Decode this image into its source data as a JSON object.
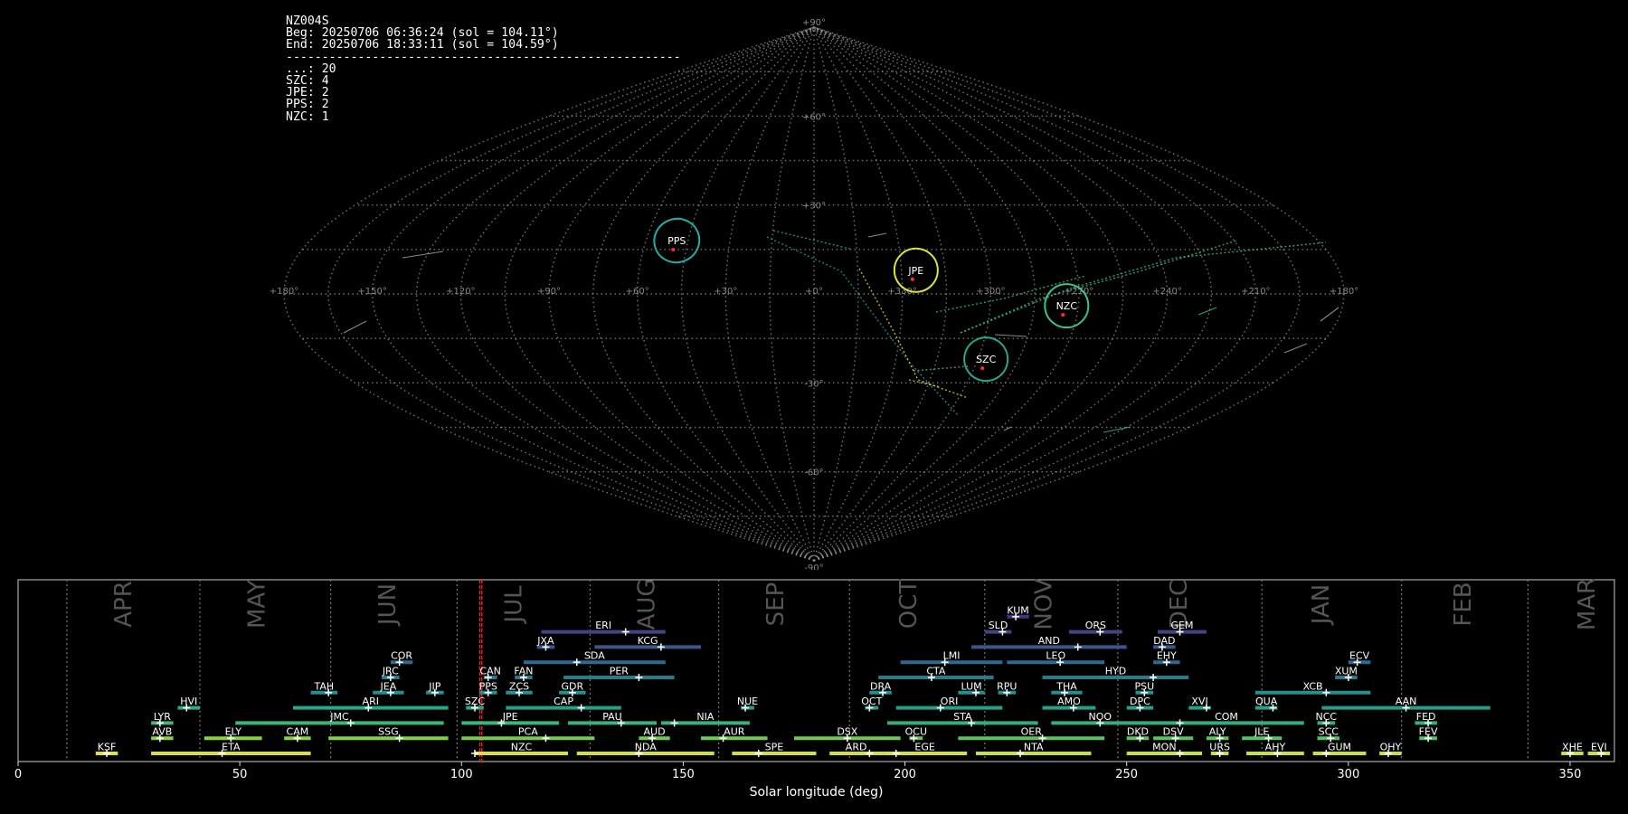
{
  "info": {
    "lines": [
      "NZ004S",
      "Beg: 20250706 06:36:24 (sol = 104.11°)",
      "End: 20250706 18:33:11 (sol = 104.59°)",
      "-------------------------------------------------------",
      "...: 20",
      "SZC: 4",
      "JPE: 2",
      "PPS: 2",
      "NZC: 1"
    ]
  },
  "sky_map": {
    "projection": "sinusoidal",
    "lon_tick_labels": [
      "+180°",
      "+150°",
      "+120°",
      "+90°",
      "+60°",
      "+30°",
      "+0°",
      "+330°",
      "+300°",
      "+270°",
      "+240°",
      "+210°",
      "+180°"
    ],
    "lat_tick_labels": [
      "+90°",
      "+60°",
      "+30°",
      "-30°",
      "-60°",
      "-90°"
    ],
    "grid_color": "#9a9a9a",
    "radiants": [
      {
        "code": "PPS",
        "lon": 49,
        "lat": 18,
        "color": "#20b0a8"
      },
      {
        "code": "JPE",
        "lon": -35,
        "lat": 8,
        "color": "#dde040"
      },
      {
        "code": "NZC",
        "lon": -86,
        "lat": -4,
        "color": "#3cc488"
      },
      {
        "code": "SZC",
        "lon": -63,
        "lat": -22,
        "color": "#24a88c"
      }
    ]
  },
  "chart_data": {
    "type": "bar",
    "title": "",
    "xlabel": "Solar longitude (deg)",
    "ylabel": "",
    "xlim": [
      0,
      360
    ],
    "x_ticks": [
      0,
      50,
      100,
      150,
      200,
      250,
      300,
      350
    ],
    "current_sol": [
      104.11,
      104.59
    ],
    "months": [
      {
        "name": "APR",
        "boundary": 11,
        "label_at": 24
      },
      {
        "name": "MAY",
        "boundary": 41,
        "label_at": 54
      },
      {
        "name": "JUN",
        "boundary": 70.5,
        "label_at": 83.5
      },
      {
        "name": "JUL",
        "boundary": 99,
        "label_at": 112
      },
      {
        "name": "AUG",
        "boundary": 129,
        "label_at": 142
      },
      {
        "name": "SEP",
        "boundary": 158,
        "label_at": 171
      },
      {
        "name": "OCT",
        "boundary": 187.5,
        "label_at": 201
      },
      {
        "name": "NOV",
        "boundary": 218,
        "label_at": 231.5
      },
      {
        "name": "DEC",
        "boundary": 248,
        "label_at": 262
      },
      {
        "name": "JAN",
        "boundary": 280.5,
        "label_at": 294
      },
      {
        "name": "FEB",
        "boundary": 312,
        "label_at": 326
      },
      {
        "name": "MAR",
        "boundary": 340.5,
        "label_at": 354
      }
    ],
    "showers": [
      {
        "code": "KSF",
        "start": 17.5,
        "end": 22.5,
        "peak": 20,
        "row": 0,
        "color": "#e0e040"
      },
      {
        "code": "ETA",
        "start": 30,
        "end": 66,
        "peak": 46,
        "row": 0,
        "color": "#d8e040"
      },
      {
        "code": "NZC",
        "start": 103,
        "end": 124,
        "peak": 103,
        "row": 0,
        "color": "#d8e040"
      },
      {
        "code": "NDA",
        "start": 126,
        "end": 157,
        "peak": 140,
        "row": 0,
        "color": "#d0e040"
      },
      {
        "code": "SPE",
        "start": 161,
        "end": 180,
        "peak": 167,
        "row": 0,
        "color": "#d0e040"
      },
      {
        "code": "ARD",
        "start": 183,
        "end": 195,
        "peak": 192,
        "row": 0,
        "color": "#d0e040"
      },
      {
        "code": "EGE",
        "start": 195,
        "end": 214,
        "peak": 198,
        "row": 0,
        "color": "#d0e040"
      },
      {
        "code": "NTA",
        "start": 216,
        "end": 242,
        "peak": 226,
        "row": 0,
        "color": "#c8e040"
      },
      {
        "code": "MON",
        "start": 250,
        "end": 267,
        "peak": 262,
        "row": 0,
        "color": "#c8e040"
      },
      {
        "code": "URS",
        "start": 269,
        "end": 273,
        "peak": 271,
        "row": 0,
        "color": "#c8e040"
      },
      {
        "code": "AHY",
        "start": 277,
        "end": 290,
        "peak": 284,
        "row": 0,
        "color": "#c8e040"
      },
      {
        "code": "GUM",
        "start": 292,
        "end": 304,
        "peak": 295,
        "row": 0,
        "color": "#c8e040"
      },
      {
        "code": "OHY",
        "start": 307,
        "end": 312,
        "peak": 309,
        "row": 0,
        "color": "#c8e040"
      },
      {
        "code": "XHE",
        "start": 348,
        "end": 353,
        "peak": 350,
        "row": 0,
        "color": "#c8e040"
      },
      {
        "code": "EVI",
        "start": 354,
        "end": 359,
        "peak": 357,
        "row": 0,
        "color": "#c8e040"
      },
      {
        "code": "AVB",
        "start": 30,
        "end": 35,
        "peak": 32,
        "row": 1,
        "color": "#88d048"
      },
      {
        "code": "ELY",
        "start": 42,
        "end": 55,
        "peak": 48,
        "row": 1,
        "color": "#88d048"
      },
      {
        "code": "CAM",
        "start": 60,
        "end": 66,
        "peak": 63,
        "row": 1,
        "color": "#88d048"
      },
      {
        "code": "SSG",
        "start": 70,
        "end": 97,
        "peak": 86,
        "row": 1,
        "color": "#80d050"
      },
      {
        "code": "PCA",
        "start": 100,
        "end": 130,
        "peak": 119,
        "row": 1,
        "color": "#78c858"
      },
      {
        "code": "AUD",
        "start": 140,
        "end": 147,
        "peak": 143,
        "row": 1,
        "color": "#70c858"
      },
      {
        "code": "AUR",
        "start": 154,
        "end": 169,
        "peak": 159,
        "row": 1,
        "color": "#70c858"
      },
      {
        "code": "DSX",
        "start": 175,
        "end": 199,
        "peak": 187,
        "row": 1,
        "color": "#70c858"
      },
      {
        "code": "OCU",
        "start": 201,
        "end": 204,
        "peak": 202,
        "row": 1,
        "color": "#68c060"
      },
      {
        "code": "OER",
        "start": 212,
        "end": 245,
        "peak": 231,
        "row": 1,
        "color": "#60c060"
      },
      {
        "code": "DKD",
        "start": 250,
        "end": 255,
        "peak": 253,
        "row": 1,
        "color": "#60c060"
      },
      {
        "code": "DSV",
        "start": 256,
        "end": 265,
        "peak": 261,
        "row": 1,
        "color": "#60c060"
      },
      {
        "code": "ALY",
        "start": 268,
        "end": 273,
        "peak": 271,
        "row": 1,
        "color": "#60c060"
      },
      {
        "code": "JLE",
        "start": 276,
        "end": 285,
        "peak": 282,
        "row": 1,
        "color": "#58c068"
      },
      {
        "code": "SCC",
        "start": 293,
        "end": 298,
        "peak": 296,
        "row": 1,
        "color": "#58c068"
      },
      {
        "code": "FEV",
        "start": 316,
        "end": 320,
        "peak": 318,
        "row": 1,
        "color": "#58c068"
      },
      {
        "code": "LYR",
        "start": 30,
        "end": 35,
        "peak": 32,
        "row": 2,
        "color": "#40b878"
      },
      {
        "code": "JMC",
        "start": 49,
        "end": 96,
        "peak": 75,
        "row": 2,
        "color": "#38b878"
      },
      {
        "code": "JPE",
        "start": 100,
        "end": 122,
        "peak": 109,
        "row": 2,
        "color": "#38b878"
      },
      {
        "code": "PAU",
        "start": 124,
        "end": 144,
        "peak": 136,
        "row": 2,
        "color": "#38b080"
      },
      {
        "code": "NIA",
        "start": 145,
        "end": 165,
        "peak": 148,
        "row": 2,
        "color": "#38b080"
      },
      {
        "code": "STA",
        "start": 196,
        "end": 230,
        "peak": 215,
        "row": 2,
        "color": "#30b080"
      },
      {
        "code": "NOO",
        "start": 233,
        "end": 255,
        "peak": 244,
        "row": 2,
        "color": "#30b080"
      },
      {
        "code": "COM",
        "start": 255,
        "end": 290,
        "peak": 262,
        "row": 2,
        "color": "#30b080"
      },
      {
        "code": "NCC",
        "start": 293,
        "end": 297,
        "peak": 295,
        "row": 2,
        "color": "#30b080"
      },
      {
        "code": "FED",
        "start": 315,
        "end": 320,
        "peak": 318,
        "row": 2,
        "color": "#30b080"
      },
      {
        "code": "HVI",
        "start": 36,
        "end": 41,
        "peak": 38,
        "row": 3,
        "color": "#2aa888"
      },
      {
        "code": "ARI",
        "start": 62,
        "end": 97,
        "peak": 79,
        "row": 3,
        "color": "#28a888"
      },
      {
        "code": "SZC",
        "start": 101,
        "end": 105,
        "peak": 103,
        "row": 3,
        "color": "#28a888"
      },
      {
        "code": "CAP",
        "start": 110,
        "end": 136,
        "peak": 127,
        "row": 3,
        "color": "#28a088"
      },
      {
        "code": "NUE",
        "start": 163,
        "end": 166,
        "peak": 164,
        "row": 3,
        "color": "#28a088"
      },
      {
        "code": "OCT",
        "start": 191,
        "end": 194,
        "peak": 192,
        "row": 3,
        "color": "#28a088"
      },
      {
        "code": "ORI",
        "start": 198,
        "end": 222,
        "peak": 208,
        "row": 3,
        "color": "#28a088"
      },
      {
        "code": "AMO",
        "start": 231,
        "end": 243,
        "peak": 238,
        "row": 3,
        "color": "#28a088"
      },
      {
        "code": "DPC",
        "start": 250,
        "end": 256,
        "peak": 253,
        "row": 3,
        "color": "#28a088"
      },
      {
        "code": "XVI",
        "start": 264,
        "end": 269,
        "peak": 268,
        "row": 3,
        "color": "#28a088"
      },
      {
        "code": "QUA",
        "start": 279,
        "end": 284,
        "peak": 283,
        "row": 3,
        "color": "#28a088"
      },
      {
        "code": "AAN",
        "start": 294,
        "end": 332,
        "peak": 313,
        "row": 3,
        "color": "#289c88"
      },
      {
        "code": "TAH",
        "start": 66,
        "end": 72,
        "peak": 70,
        "row": 4,
        "color": "#23908c"
      },
      {
        "code": "JEA",
        "start": 80,
        "end": 87,
        "peak": 84,
        "row": 4,
        "color": "#23908c"
      },
      {
        "code": "JIP",
        "start": 92,
        "end": 96,
        "peak": 94,
        "row": 4,
        "color": "#23908c"
      },
      {
        "code": "PPS",
        "start": 104,
        "end": 108,
        "peak": 106,
        "row": 4,
        "color": "#23908c"
      },
      {
        "code": "ZCS",
        "start": 110,
        "end": 116,
        "peak": 113,
        "row": 4,
        "color": "#23908c"
      },
      {
        "code": "GDR",
        "start": 122,
        "end": 128,
        "peak": 125,
        "row": 4,
        "color": "#23908c"
      },
      {
        "code": "DRA",
        "start": 192,
        "end": 197,
        "peak": 195,
        "row": 4,
        "color": "#23908c"
      },
      {
        "code": "LUM",
        "start": 212,
        "end": 218,
        "peak": 216,
        "row": 4,
        "color": "#23908c"
      },
      {
        "code": "RPU",
        "start": 221,
        "end": 225,
        "peak": 223,
        "row": 4,
        "color": "#23908c"
      },
      {
        "code": "THA",
        "start": 233,
        "end": 240,
        "peak": 236,
        "row": 4,
        "color": "#23908c"
      },
      {
        "code": "PSU",
        "start": 252,
        "end": 256,
        "peak": 254,
        "row": 4,
        "color": "#23908c"
      },
      {
        "code": "XCB",
        "start": 279,
        "end": 305,
        "peak": 295,
        "row": 4,
        "color": "#23908c"
      },
      {
        "code": "JRC",
        "start": 82,
        "end": 86,
        "peak": 84,
        "row": 5,
        "color": "#2a7a8e"
      },
      {
        "code": "CAN",
        "start": 105,
        "end": 108,
        "peak": 106,
        "row": 5,
        "color": "#2a7a8e"
      },
      {
        "code": "FAN",
        "start": 112,
        "end": 116,
        "peak": 114,
        "row": 5,
        "color": "#2a7a8e"
      },
      {
        "code": "PER",
        "start": 123,
        "end": 148,
        "peak": 140,
        "row": 5,
        "color": "#2a7a8e"
      },
      {
        "code": "CTA",
        "start": 194,
        "end": 220,
        "peak": 206,
        "row": 5,
        "color": "#2a7a8e"
      },
      {
        "code": "HYD",
        "start": 231,
        "end": 264,
        "peak": 256,
        "row": 5,
        "color": "#2a7a8e"
      },
      {
        "code": "XUM",
        "start": 297,
        "end": 302,
        "peak": 300,
        "row": 5,
        "color": "#2a7a8e"
      },
      {
        "code": "COR",
        "start": 84,
        "end": 89,
        "peak": 86,
        "row": 6,
        "color": "#30688e"
      },
      {
        "code": "SDA",
        "start": 114,
        "end": 146,
        "peak": 126,
        "row": 6,
        "color": "#30688e"
      },
      {
        "code": "LMI",
        "start": 199,
        "end": 222,
        "peak": 209,
        "row": 6,
        "color": "#30688e"
      },
      {
        "code": "LEO",
        "start": 223,
        "end": 245,
        "peak": 235,
        "row": 6,
        "color": "#30688e"
      },
      {
        "code": "EHY",
        "start": 256,
        "end": 262,
        "peak": 259,
        "row": 6,
        "color": "#30688e"
      },
      {
        "code": "ECV",
        "start": 300,
        "end": 305,
        "peak": 302,
        "row": 6,
        "color": "#30688e"
      },
      {
        "code": "JXA",
        "start": 117,
        "end": 121,
        "peak": 119,
        "row": 7,
        "color": "#38578c"
      },
      {
        "code": "KCG",
        "start": 130,
        "end": 154,
        "peak": 145,
        "row": 7,
        "color": "#38578c"
      },
      {
        "code": "AND",
        "start": 215,
        "end": 250,
        "peak": 239,
        "row": 7,
        "color": "#38578c"
      },
      {
        "code": "DAD",
        "start": 256,
        "end": 261,
        "peak": 258,
        "row": 7,
        "color": "#38578c"
      },
      {
        "code": "ERI",
        "start": 118,
        "end": 146,
        "peak": 137,
        "row": 8,
        "color": "#414487"
      },
      {
        "code": "SLD",
        "start": 218,
        "end": 224,
        "peak": 222,
        "row": 8,
        "color": "#414487"
      },
      {
        "code": "ORS",
        "start": 237,
        "end": 249,
        "peak": 244,
        "row": 8,
        "color": "#414487"
      },
      {
        "code": "GEM",
        "start": 257,
        "end": 268,
        "peak": 262,
        "row": 8,
        "color": "#414487"
      },
      {
        "code": "KUM",
        "start": 223,
        "end": 228,
        "peak": 225,
        "row": 9,
        "color": "#46327e"
      }
    ]
  }
}
